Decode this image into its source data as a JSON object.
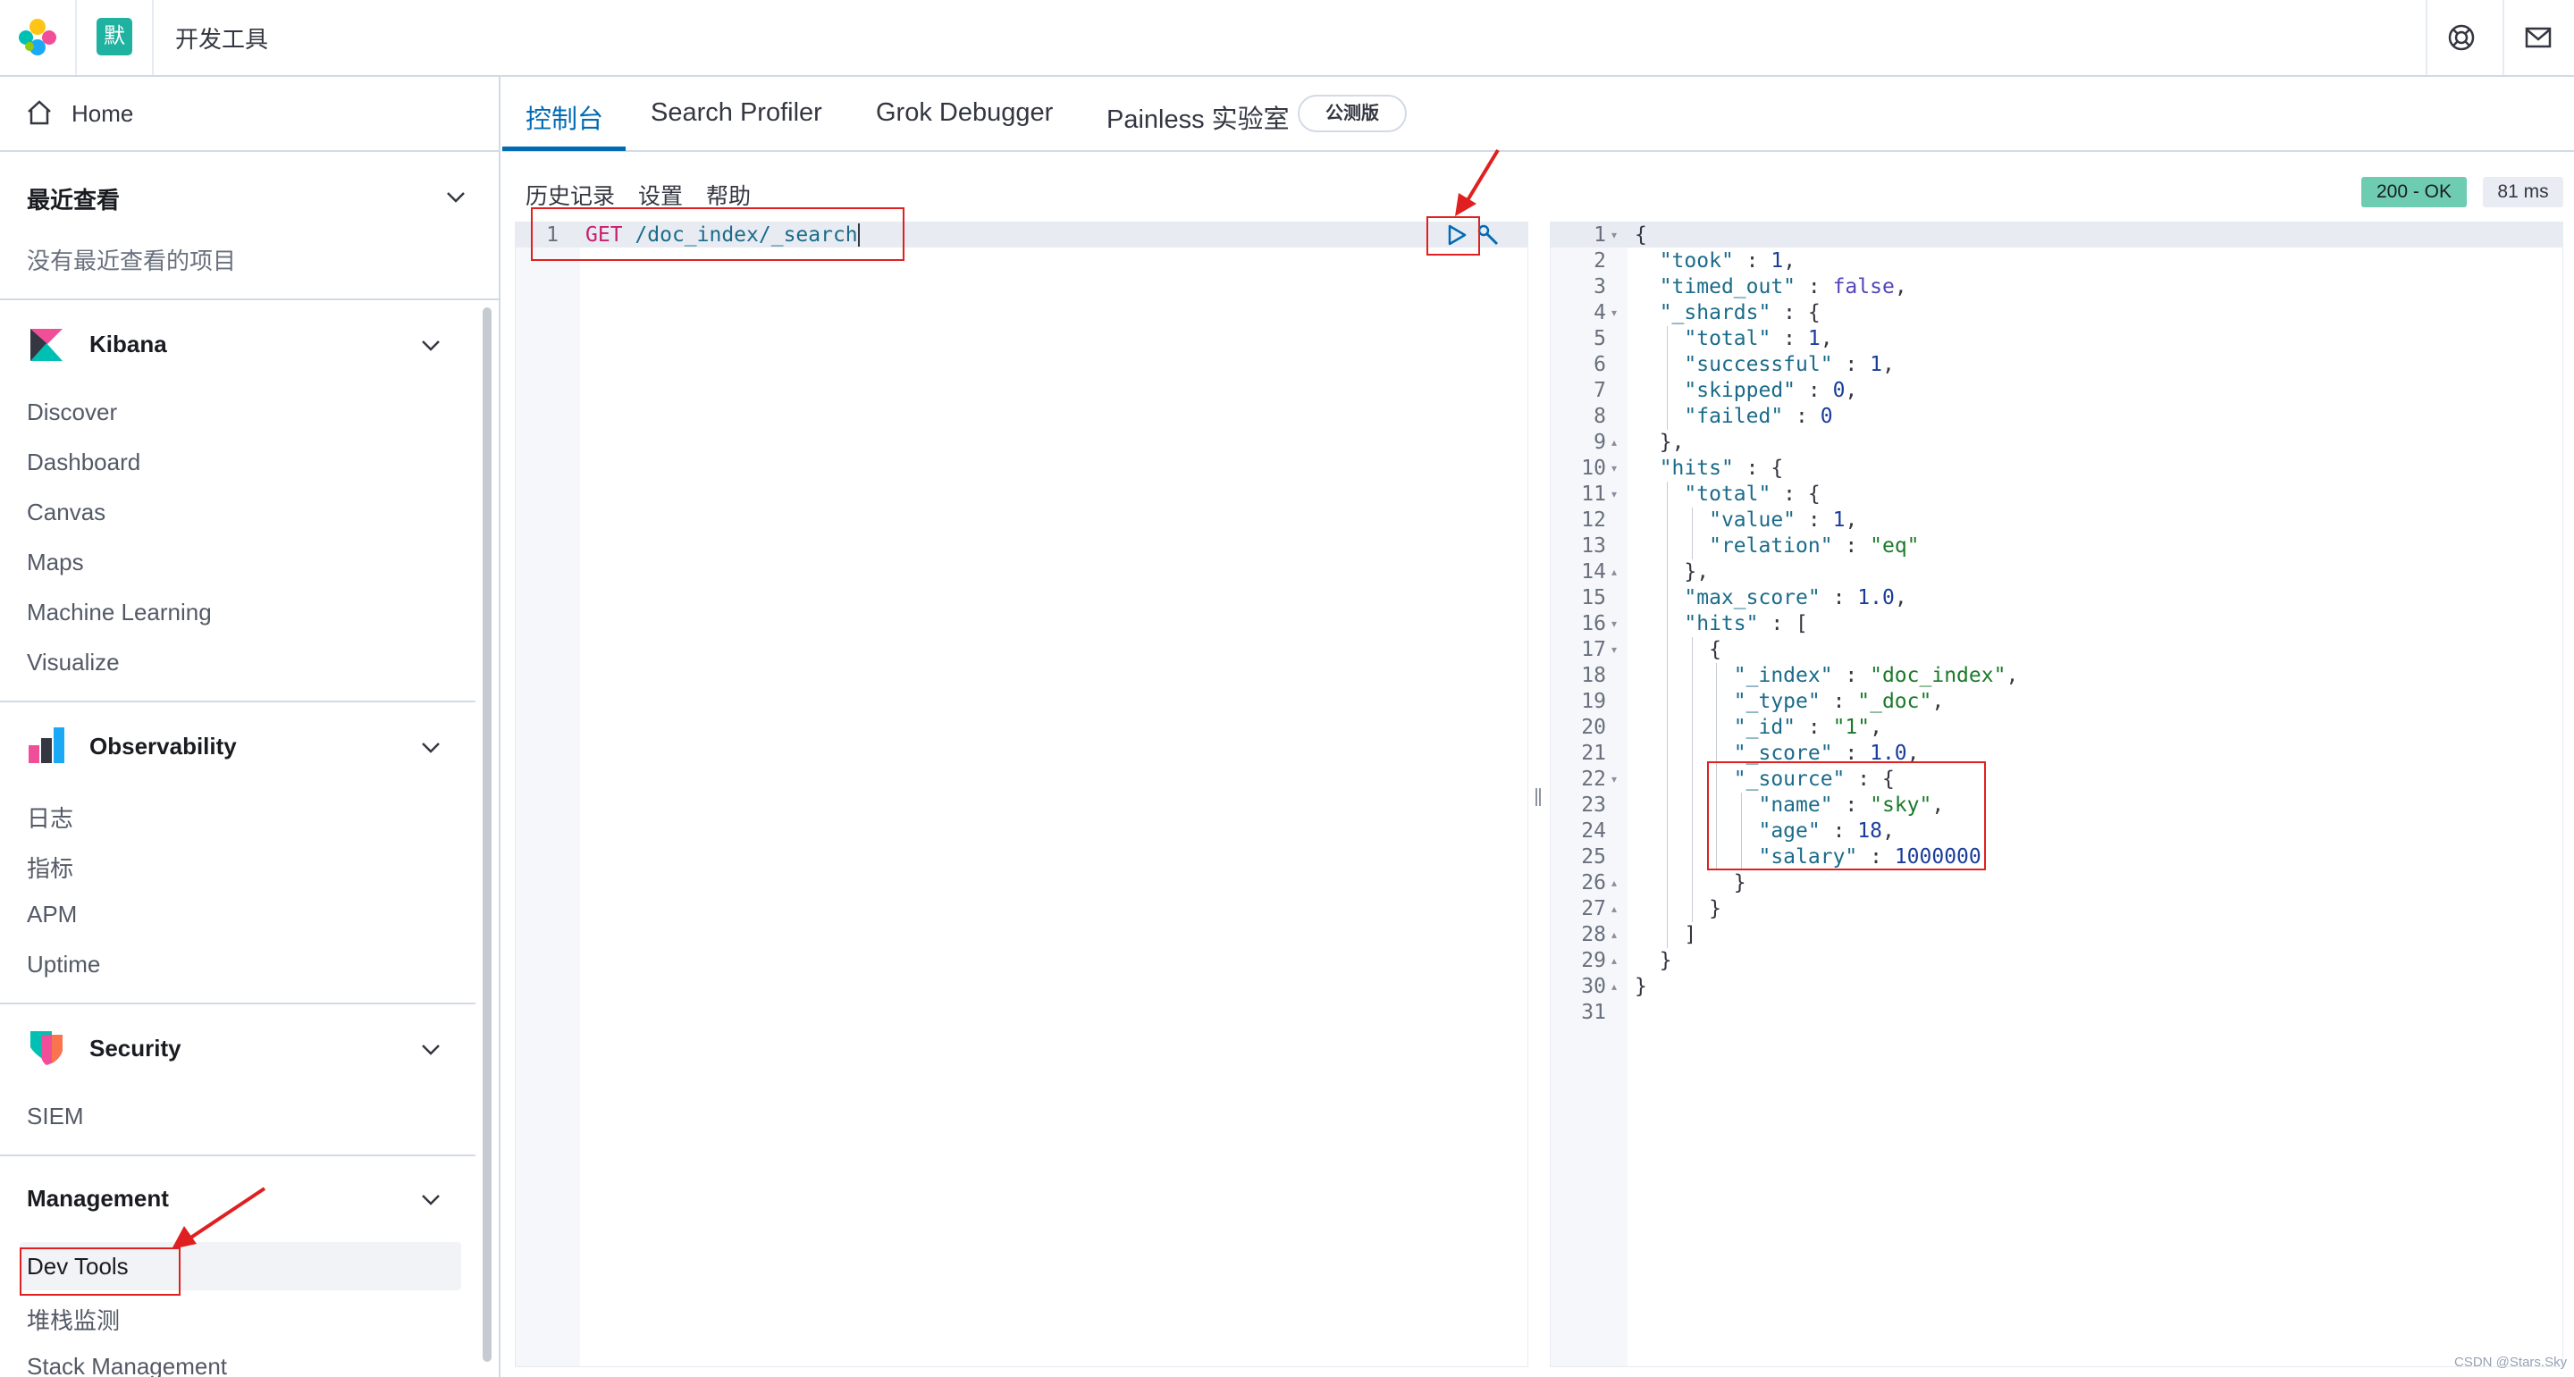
{
  "header": {
    "space_initial": "默",
    "app_title": "开发工具",
    "icons": [
      "help-icon",
      "mail-icon"
    ]
  },
  "sidebar": {
    "home": "Home",
    "recent": {
      "title": "最近查看",
      "empty": "没有最近查看的项目"
    },
    "groups": [
      {
        "title": "Kibana",
        "logo": "kibana-logo-icon",
        "items": [
          "Discover",
          "Dashboard",
          "Canvas",
          "Maps",
          "Machine Learning",
          "Visualize"
        ]
      },
      {
        "title": "Observability",
        "logo": "observability-logo-icon",
        "items": [
          "日志",
          "指标",
          "APM",
          "Uptime"
        ]
      },
      {
        "title": "Security",
        "logo": "security-logo-icon",
        "items": [
          "SIEM"
        ]
      },
      {
        "title": "Management",
        "items": [
          "Dev Tools",
          "堆栈监测",
          "Stack Management"
        ]
      }
    ],
    "selected": "Dev Tools"
  },
  "tabs": [
    {
      "label": "控制台",
      "active": true
    },
    {
      "label": "Search Profiler"
    },
    {
      "label": "Grok Debugger"
    },
    {
      "label": "Painless 实验室"
    }
  ],
  "beta_badge": "公测版",
  "console_menu": [
    "历史记录",
    "设置",
    "帮助"
  ],
  "response_status": "200 - OK",
  "response_time": "81 ms",
  "request": {
    "line_number": "1",
    "method": "GET",
    "path": "/doc_index/_search"
  },
  "response_lines": [
    "{",
    "  \"took\" : 1,",
    "  \"timed_out\" : false,",
    "  \"_shards\" : {",
    "    \"total\" : 1,",
    "    \"successful\" : 1,",
    "    \"skipped\" : 0,",
    "    \"failed\" : 0",
    "  },",
    "  \"hits\" : {",
    "    \"total\" : {",
    "      \"value\" : 1,",
    "      \"relation\" : \"eq\"",
    "    },",
    "    \"max_score\" : 1.0,",
    "    \"hits\" : [",
    "      {",
    "        \"_index\" : \"doc_index\",",
    "        \"_type\" : \"_doc\",",
    "        \"_id\" : \"1\",",
    "        \"_score\" : 1.0,",
    "        \"_source\" : {",
    "          \"name\" : \"sky\",",
    "          \"age\" : 18,",
    "          \"salary\" : 1000000",
    "        }",
    "      }",
    "    ]",
    "  }",
    "}",
    ""
  ],
  "fold_lines": {
    "open": [
      1,
      4,
      10,
      11,
      16,
      17,
      22
    ],
    "close": [
      9,
      14,
      26,
      27,
      28,
      29,
      30
    ]
  },
  "watermark": "CSDN @Stars.Sky",
  "colors": {
    "accent": "#006bb4",
    "status_ok": "#6dccb1",
    "annotation": "#e02020",
    "space_badge": "#20b2a0"
  }
}
